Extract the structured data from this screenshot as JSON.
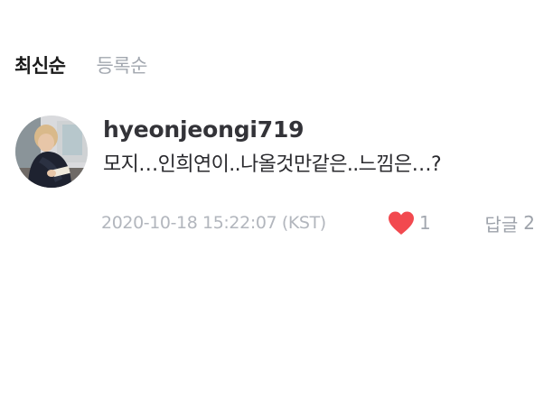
{
  "sort_tabs": {
    "latest": "최신순",
    "registered": "등록순"
  },
  "comment": {
    "username": "hyeonjeongi719",
    "text": "모지…인희연이..나올것만같은..느낌은…?",
    "timestamp": "2020-10-18 15:22:07 (KST)",
    "likes": "1",
    "reply_label": "답글",
    "reply_count": "2",
    "avatar_icon": "user-photo"
  },
  "colors": {
    "heart": "#f2494f",
    "muted_text": "#a3a8b0",
    "primary_text": "#1a1a1a"
  }
}
